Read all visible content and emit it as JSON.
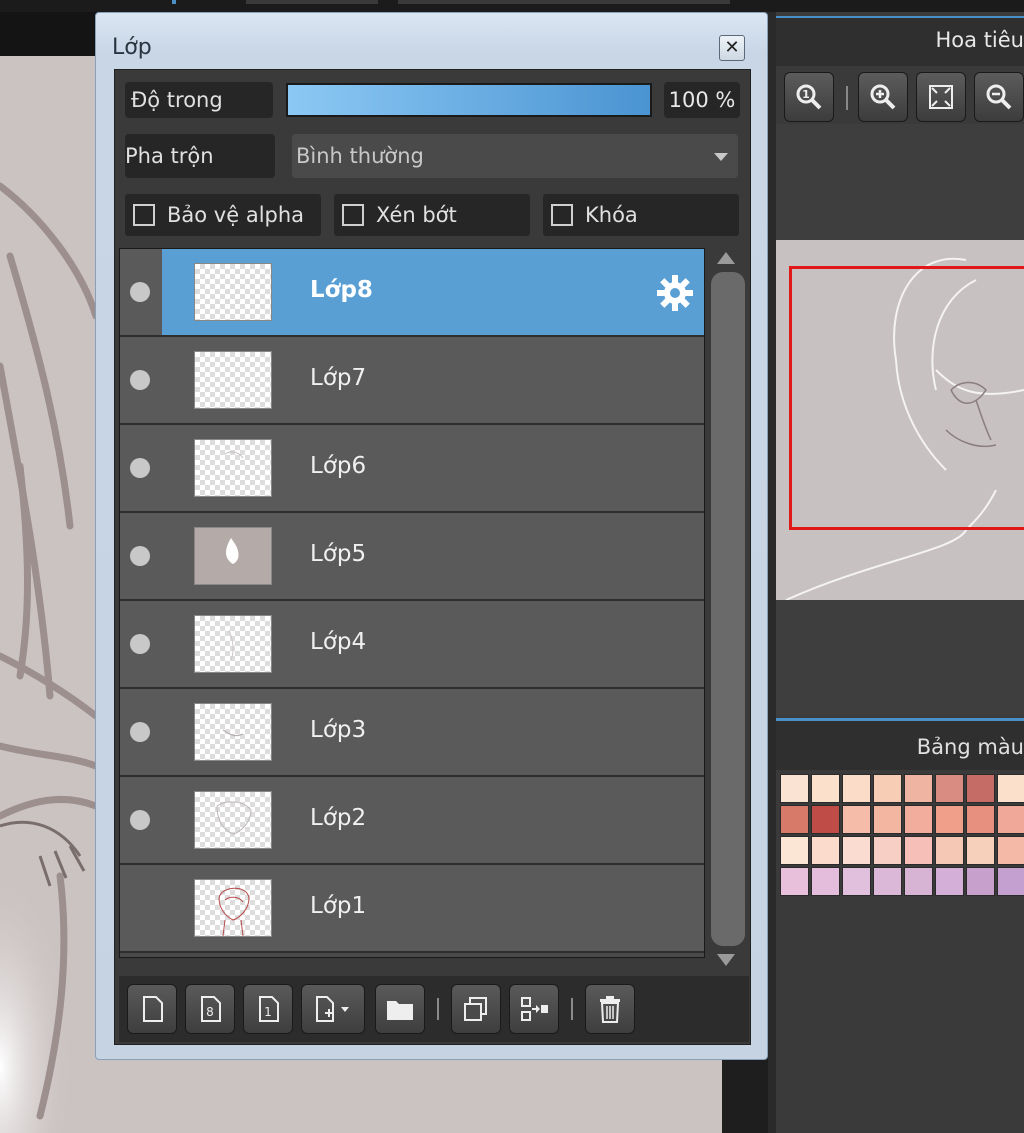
{
  "layer_panel": {
    "title": "Lớp",
    "close_glyph": "✕",
    "opacity_label": "Độ trong",
    "opacity_value": "100 %",
    "opacity_fraction": 1.0,
    "blend_label": "Pha trộn",
    "blend_value": "Bình thường",
    "checkboxes": [
      {
        "label": "Bảo vệ alpha",
        "checked": false
      },
      {
        "label": "Xén bớt",
        "checked": false
      },
      {
        "label": "Khóa",
        "checked": false
      }
    ],
    "layers": [
      {
        "name": "Lớp8",
        "visible": true,
        "selected": true
      },
      {
        "name": "Lớp7",
        "visible": true,
        "selected": false
      },
      {
        "name": "Lớp6",
        "visible": true,
        "selected": false
      },
      {
        "name": "Lớp5",
        "visible": true,
        "selected": false
      },
      {
        "name": "Lớp4",
        "visible": true,
        "selected": false
      },
      {
        "name": "Lớp3",
        "visible": true,
        "selected": false
      },
      {
        "name": "Lớp2",
        "visible": true,
        "selected": false
      },
      {
        "name": "Lớp1",
        "visible": false,
        "selected": false
      }
    ],
    "toolbar_icons": [
      "new-layer-icon",
      "new-8bit-layer-icon",
      "new-1bit-layer-icon",
      "add-layer-dropdown-icon",
      "folder-icon",
      "duplicate-layer-icon",
      "merge-down-icon",
      "trash-icon"
    ]
  },
  "navigator": {
    "title": "Hoa tiêu",
    "tools": [
      "zoom-actual-icon",
      "zoom-in-icon",
      "fit-screen-icon",
      "zoom-out-icon"
    ]
  },
  "palette": {
    "title": "Bảng màu",
    "colors": [
      "#fbe3d3",
      "#fbe0cc",
      "#fbdcc8",
      "#f7cdb5",
      "#f0b4a3",
      "#d88c82",
      "#c56c66",
      "#fbe0cc",
      "#f7d6c0",
      "#d87a6a",
      "#c04c48",
      "#f6bcaa",
      "#f3b6a0",
      "#f2ad9c",
      "#f0a08a",
      "#e89080",
      "#f0a898",
      "#e88c80",
      "#fbe6d6",
      "#fbdccc",
      "#fbdcd0",
      "#f8cfc4",
      "#f6c0b8",
      "#f4c8b4",
      "#f7d0bc",
      "#f5b9a8",
      "#f3b0a0",
      "#e8c0dc",
      "#e4bcdc",
      "#e0c0dc",
      "#dcb8d8",
      "#d8b4d4",
      "#d4b0d8",
      "#c8a0cc",
      "#c4a0d0",
      "#bca0cc"
    ]
  }
}
